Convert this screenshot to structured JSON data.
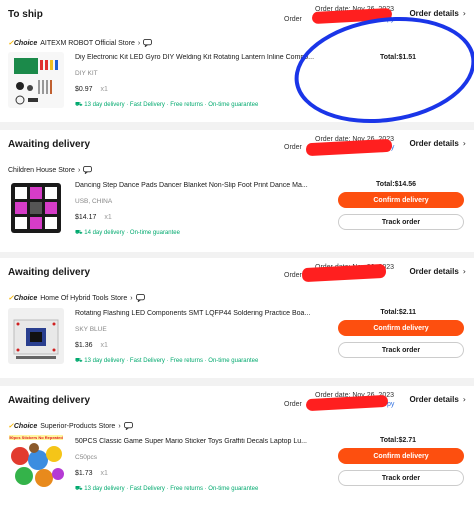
{
  "orders": [
    {
      "status": "To ship",
      "order_date": "Order date: Nov 26, 2023",
      "order_label": "Order",
      "copy": "Copy",
      "details": "Order details",
      "choice": true,
      "store": "AITEXM ROBOT Official Store",
      "title": "Diy Electronic Kit LED Gyro DIY Welding Kit Rotating Lantern Inline Compo...",
      "variant": "DIY KIT",
      "price": "$0.97",
      "qty": "x1",
      "delivery": "13 day delivery · Fast Delivery · Free returns · On-time guarantee",
      "total": "Total:$1.51",
      "buttons": []
    },
    {
      "status": "Awaiting delivery",
      "order_date": "Order date: Nov 26, 2023",
      "order_label": "Order",
      "copy": "Copy",
      "details": "Order details",
      "choice": false,
      "store": "Children House Store",
      "title": "Dancing Step Dance Pads Dancer Blanket Non-Slip Foot Print Dance Ma...",
      "variant": "USB, CHINA",
      "price": "$14.17",
      "qty": "x1",
      "delivery": "14 day delivery · On-time guarantee",
      "total": "Total:$14.56",
      "buttons": [
        "Confirm delivery",
        "Track order"
      ]
    },
    {
      "status": "Awaiting delivery",
      "order_date": "Order date: Nov 26, 2023",
      "order_label": "Order",
      "copy": "Copy",
      "details": "Order details",
      "choice": true,
      "store": "Home Of Hybrid Tools Store",
      "title": "Rotating Flashing LED Components SMT LQFP44 Soldering Practice Boa...",
      "variant": "SKY BLUE",
      "price": "$1.36",
      "qty": "x1",
      "delivery": "13 day delivery · Fast Delivery · Free returns · On-time guarantee",
      "total": "Total:$2.11",
      "buttons": [
        "Confirm delivery",
        "Track order"
      ]
    },
    {
      "status": "Awaiting delivery",
      "order_date": "Order date: Nov 26, 2023",
      "order_label": "Order",
      "copy": "Copy",
      "details": "Order details",
      "choice": true,
      "store": "Superior-Products Store",
      "title": "50PCS Classic Game Super Mario Sticker Toys Graffiti Decals Laptop Lu...",
      "variant": "C50pcs",
      "price": "$1.73",
      "qty": "x1",
      "delivery": "13 day delivery · Fast Delivery · Free returns · On-time guarantee",
      "total": "Total:$2.71",
      "buttons": [
        "Confirm delivery",
        "Track order"
      ]
    }
  ],
  "choice_label": "Choice",
  "mario_thumb_text": "50pcs Stickers No Repeated",
  "colors": {
    "primary": "#fd4f0f",
    "green": "#00a96e",
    "link": "#2f6fe0",
    "redact": "#ff1f1f",
    "annotation": "#1a35e8"
  }
}
